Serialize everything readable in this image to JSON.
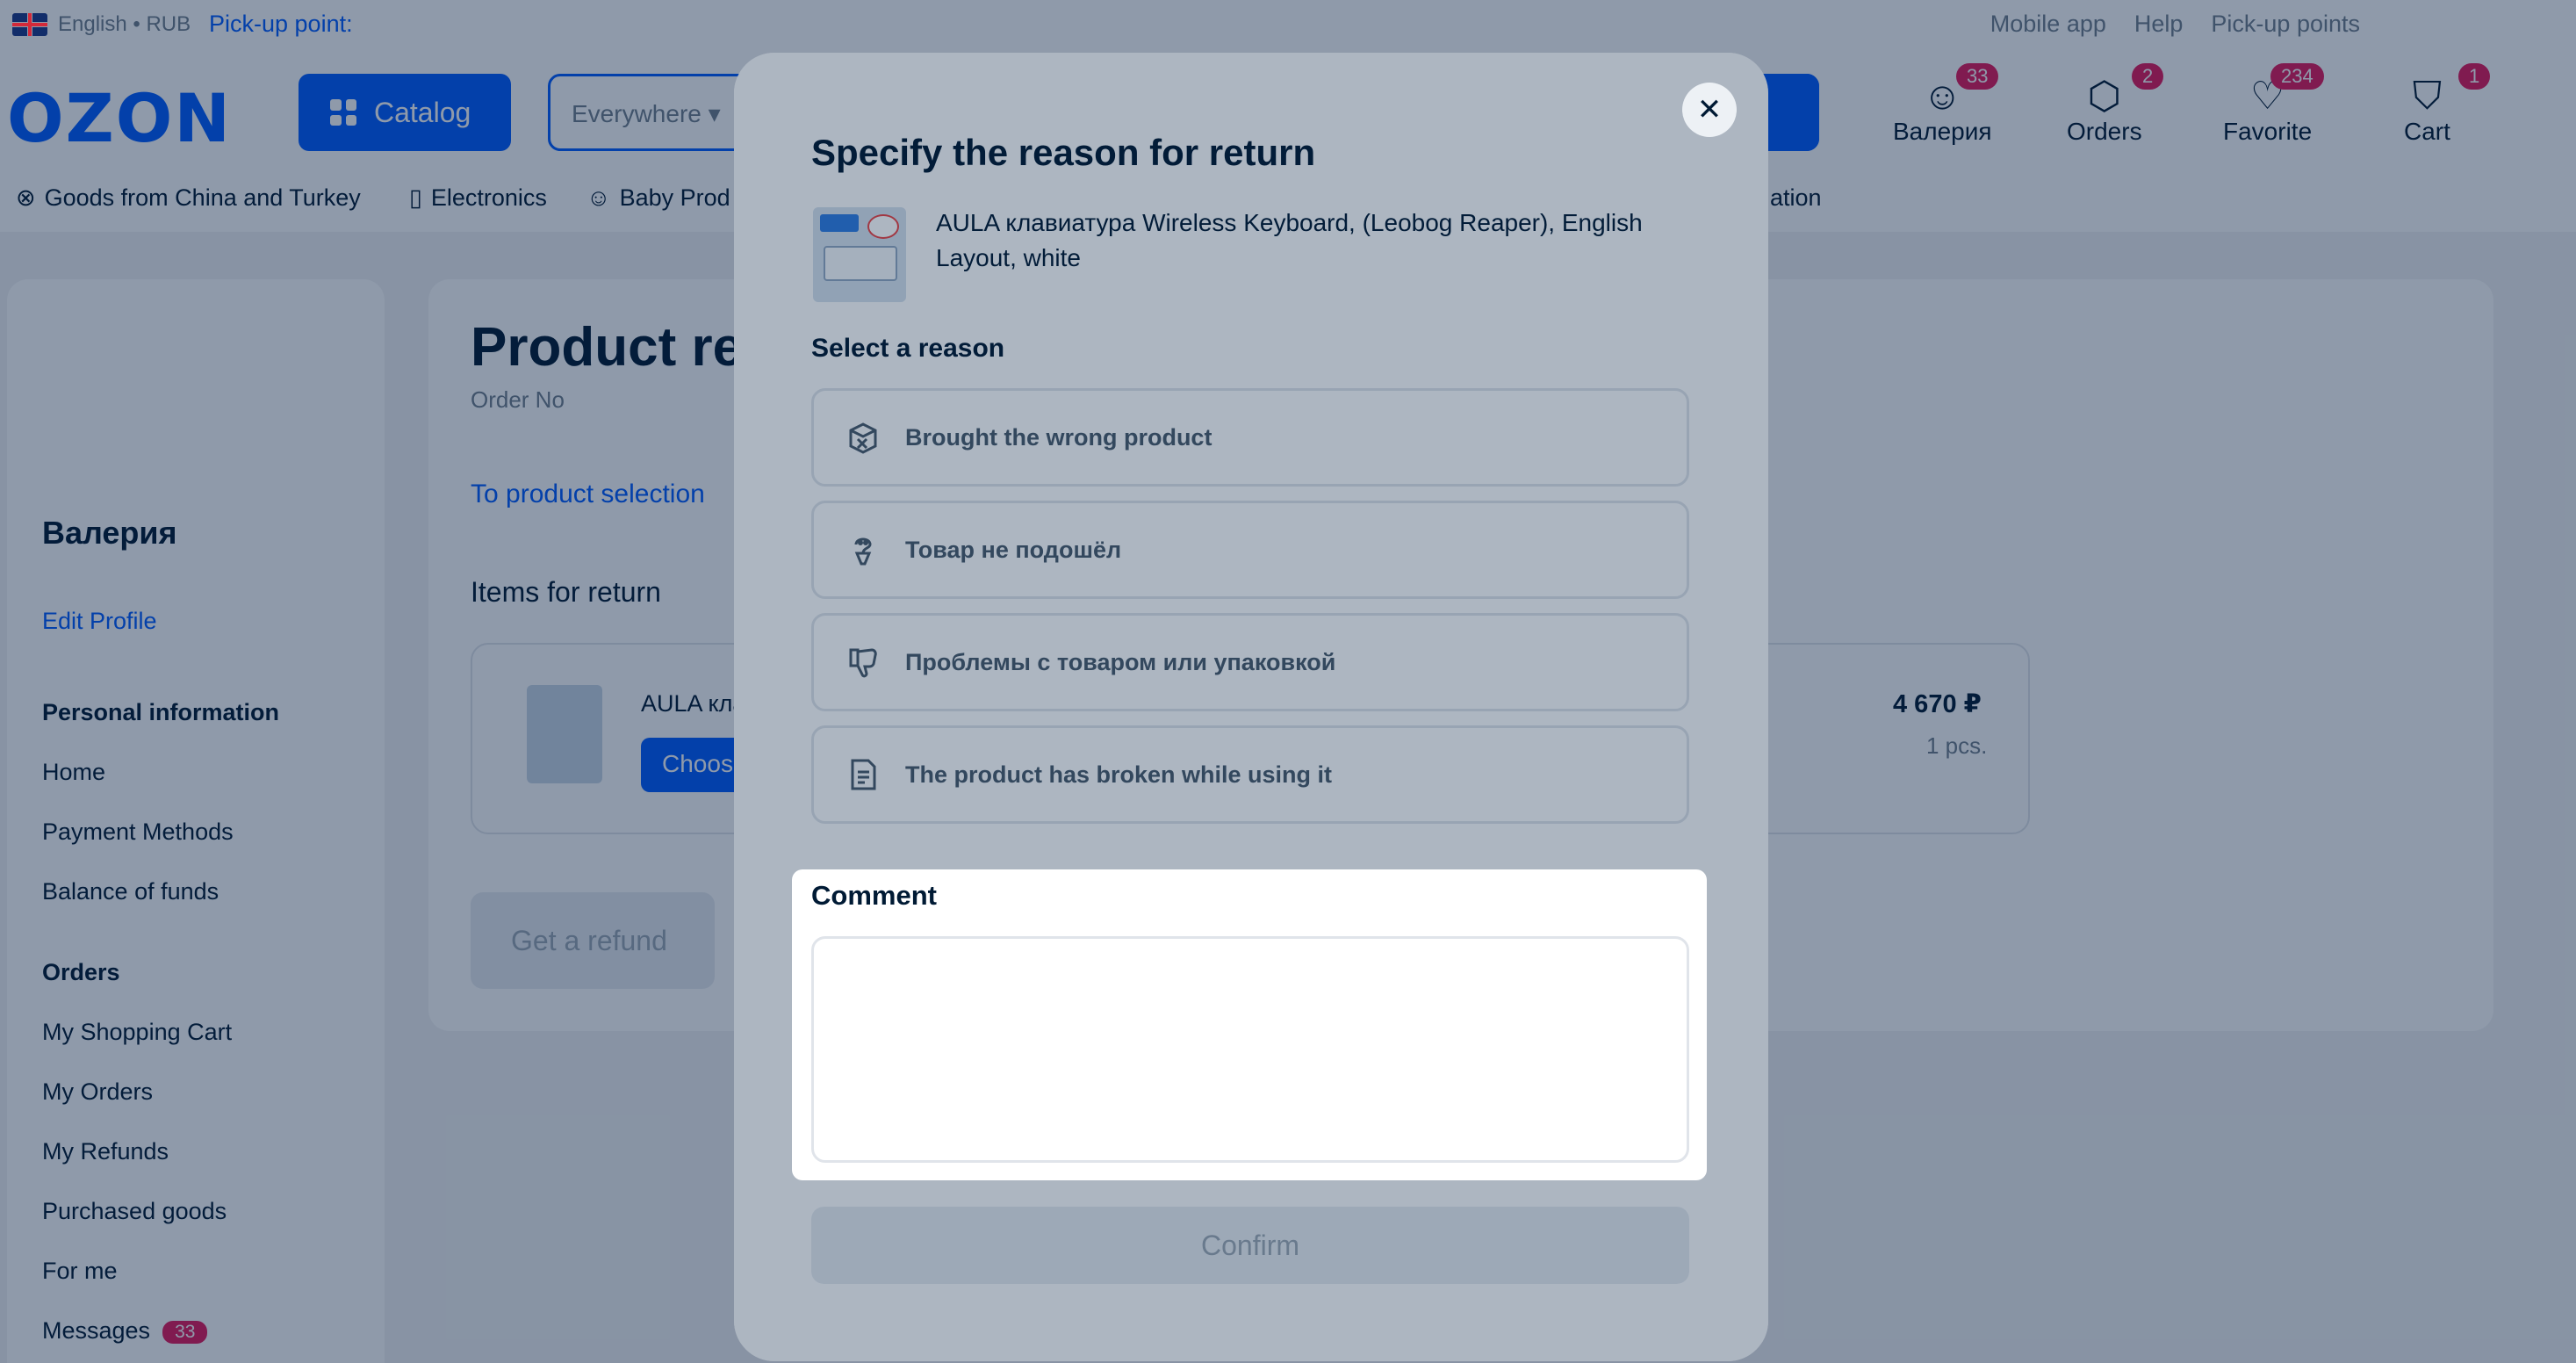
{
  "topbar": {
    "locale": "English • RUB",
    "pickup_point": "Pick-up point:",
    "links": [
      "Mobile app",
      "Help",
      "Pick-up points"
    ]
  },
  "header": {
    "logo": "OZON",
    "catalog_label": "Catalog",
    "search_scope": "Everywhere",
    "account_label": "Валерия",
    "account_badge": "33",
    "orders_label": "Orders",
    "orders_badge": "2",
    "favorite_label": "Favorite",
    "favorite_badge": "234",
    "cart_label": "Cart",
    "cart_badge": "1"
  },
  "category_bar": {
    "items": [
      "Goods from China and Turkey",
      "Electronics",
      "Baby Prod",
      "ation"
    ]
  },
  "sidebar": {
    "user_name": "Валерия",
    "edit_profile": "Edit Profile",
    "personal_info_heading": "Personal information",
    "personal_items": [
      "Home",
      "Payment Methods",
      "Balance of funds"
    ],
    "orders_heading": "Orders",
    "order_items": [
      "My Shopping Cart",
      "My Orders",
      "My Refunds",
      "Purchased goods",
      "For me"
    ],
    "messages_label": "Messages",
    "messages_badge": "33"
  },
  "main": {
    "title": "Product re",
    "order_no": "Order No",
    "to_product_selection": "To product selection",
    "items_for_return": "Items for return",
    "item_name": "AULA кла",
    "choose_label": "Choos",
    "price": "4 670 ₽",
    "quantity": "1 pcs.",
    "get_refund": "Get a refund"
  },
  "modal": {
    "close_symbol": "✕",
    "title": "Specify the reason for return",
    "product_name": "AULA клавиатура Wireless Keyboard, (Leobog Reaper), English Layout, white",
    "select_reason": "Select a reason",
    "reasons": [
      {
        "label": "Brought the wrong product",
        "icon": "box-x-icon"
      },
      {
        "label": "Товар не подошёл",
        "icon": "hanger-icon"
      },
      {
        "label": "Проблемы с товаром или упаковкой",
        "icon": "thumbs-down-icon"
      },
      {
        "label": "The product has broken while using it",
        "icon": "document-icon"
      }
    ],
    "comment_label": "Comment",
    "comment_value": "",
    "confirm_label": "Confirm"
  },
  "colors": {
    "brand": "#005bff",
    "badge": "#e4195c",
    "text": "#001a34"
  }
}
